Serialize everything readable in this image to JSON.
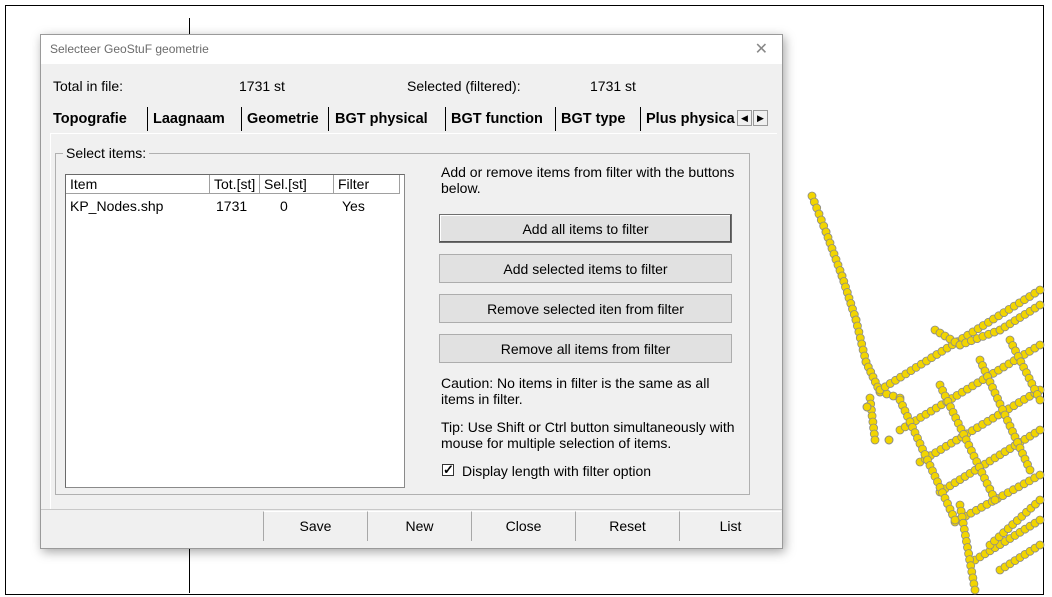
{
  "dialog": {
    "title": "Selecteer GeoStuF geometrie",
    "close_glyph": "✕"
  },
  "summary": {
    "total_label": "Total in file:",
    "total_value": "1731 st",
    "selected_label": "Selected (filtered):",
    "selected_value": "1731 st"
  },
  "tabs": [
    {
      "label": "Topografie",
      "active": true
    },
    {
      "label": "Laagnaam",
      "active": false
    },
    {
      "label": "Geometrie",
      "active": false
    },
    {
      "label": "BGT physical",
      "active": false
    },
    {
      "label": "BGT function",
      "active": false
    },
    {
      "label": "BGT type",
      "active": false
    },
    {
      "label": "Plus physica",
      "active": false
    }
  ],
  "tab_scroll": {
    "left_icon": "◀",
    "right_icon": "▶"
  },
  "group": {
    "legend": "Select items:"
  },
  "list": {
    "columns": [
      "Item",
      "Tot.[st]",
      "Sel.[st]",
      "Filter"
    ],
    "rows": [
      {
        "item": "KP_Nodes.shp",
        "tot": "1731",
        "sel": "0",
        "filter": "Yes"
      }
    ]
  },
  "help": {
    "intro": "Add or remove items from filter with the buttons below.",
    "caution": "Caution: No items in filter is the same as all items in filter.",
    "tip": "Tip: Use Shift or Ctrl button simultaneously with mouse for multiple selection of items."
  },
  "actions": {
    "add_all": "Add all items to filter",
    "add_selected": "Add selected items to filter",
    "remove_selected": "Remove selected iten from filter",
    "remove_all": "Remove all items from filter"
  },
  "option": {
    "label": "Display length with filter option",
    "checked": true
  },
  "footer": {
    "save": "Save",
    "new": "New",
    "close": "Close",
    "reset": "Reset",
    "list": "List"
  },
  "colors": {
    "map_points": "#f2d500",
    "map_outline": "#8a8a8a"
  }
}
